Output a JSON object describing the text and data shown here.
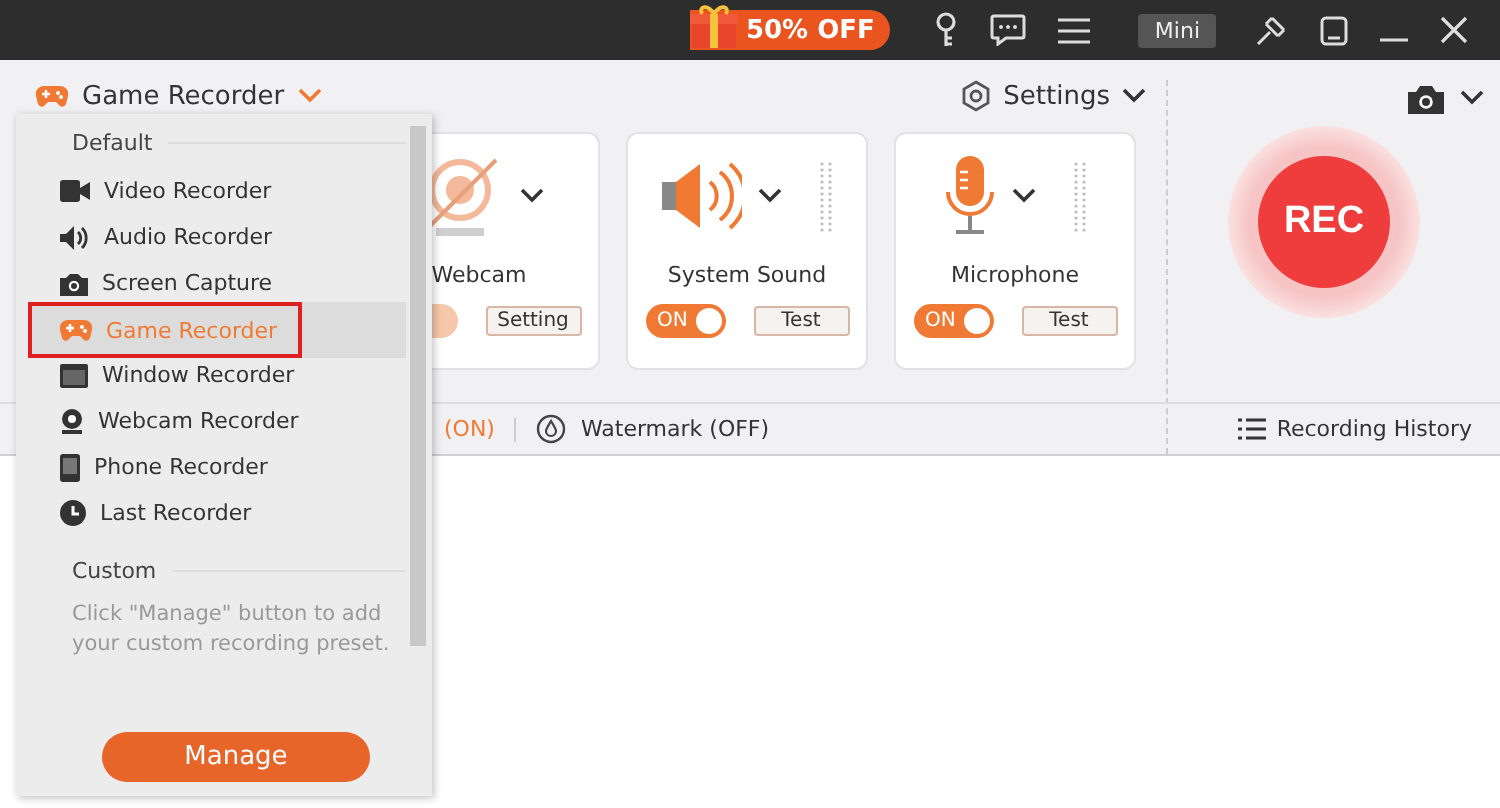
{
  "title_bar": {
    "promo": "50% OFF",
    "mini_button": "Mini"
  },
  "toolbar": {
    "mode": "Game Recorder",
    "settings": "Settings"
  },
  "sources": [
    {
      "kind": "webcam",
      "label": "Webcam",
      "on": false,
      "button": "Setting"
    },
    {
      "kind": "sound",
      "label": "System Sound",
      "on": true,
      "toggle_text": "ON",
      "button": "Test"
    },
    {
      "kind": "mic",
      "label": "Microphone",
      "on": true,
      "toggle_text": "ON",
      "button": "Test"
    }
  ],
  "rec_button": "REC",
  "status_bar": {
    "partial_text": "(ON)",
    "watermark": "Watermark (OFF)",
    "history": "Recording History"
  },
  "menu": {
    "default_heading": "Default",
    "items": [
      {
        "kind": "video",
        "label": "Video Recorder",
        "selected": false
      },
      {
        "kind": "audio",
        "label": "Audio Recorder",
        "selected": false
      },
      {
        "kind": "camera",
        "label": "Screen Capture",
        "selected": false
      },
      {
        "kind": "game",
        "label": "Game Recorder",
        "selected": true
      },
      {
        "kind": "window",
        "label": "Window Recorder",
        "selected": false
      },
      {
        "kind": "webcam",
        "label": "Webcam Recorder",
        "selected": false
      },
      {
        "kind": "phone",
        "label": "Phone Recorder",
        "selected": false
      },
      {
        "kind": "clock",
        "label": "Last Recorder",
        "selected": false
      }
    ],
    "custom_heading": "Custom",
    "custom_note": "Click \"Manage\" button to add your custom recording preset.",
    "button": "Manage"
  }
}
